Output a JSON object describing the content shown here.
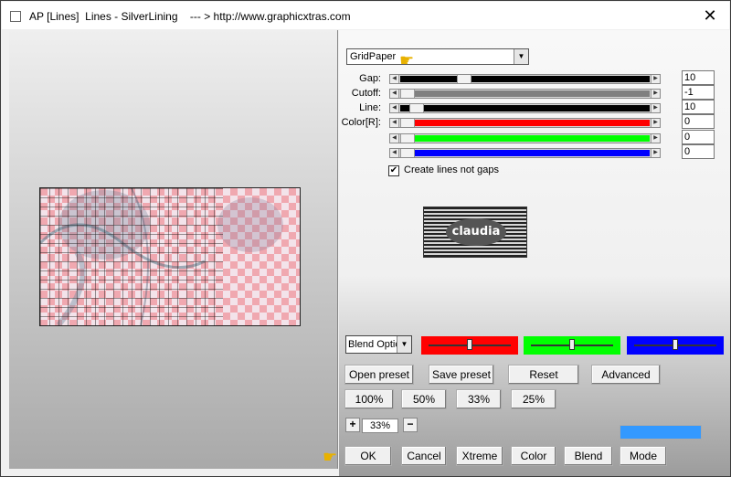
{
  "window": {
    "title": "AP [Lines]  Lines - SilverLining    --- > http://www.graphicxtras.com",
    "close_glyph": "✕"
  },
  "preset_combo": {
    "value": "GridPaper"
  },
  "params": [
    {
      "label": "Gap:",
      "value": "10",
      "color": "#000000",
      "level": 0.24
    },
    {
      "label": "Cutoff:",
      "value": "-1",
      "color": "#808080",
      "level": 0.0
    },
    {
      "label": "Line:",
      "value": "10",
      "color": "#000000",
      "level": 0.04
    },
    {
      "label": "Color[R]:",
      "value": "0",
      "color": "#ff0000",
      "level": 0.0
    },
    {
      "label": "",
      "value": "0",
      "color": "#00ff00",
      "level": 0.0
    },
    {
      "label": "",
      "value": "0",
      "color": "#0000ff",
      "level": 0.0
    }
  ],
  "checkbox": {
    "label": "Create lines not gaps",
    "checked": true,
    "mark": "✔"
  },
  "logo": {
    "text": "claudia"
  },
  "blend": {
    "value": "Blend Optio",
    "sliders": [
      {
        "color": "#ff0000",
        "level": 0.5
      },
      {
        "color": "#00ff00",
        "level": 0.5
      },
      {
        "color": "#0000ff",
        "level": 0.5
      }
    ]
  },
  "buttons": {
    "open_preset": "Open preset",
    "save_preset": "Save preset",
    "reset": "Reset",
    "advanced": "Advanced",
    "zoom_100": "100%",
    "zoom_50": "50%",
    "zoom_33": "33%",
    "zoom_25": "25%",
    "plus": "+",
    "minus": "−",
    "ok": "OK",
    "cancel": "Cancel",
    "xtreme": "Xtreme",
    "color": "Color",
    "blend": "Blend",
    "mode": "Mode"
  },
  "zoom": {
    "value": "33%"
  },
  "swatch_color": "#3399ff",
  "hand_glyph": "☛"
}
